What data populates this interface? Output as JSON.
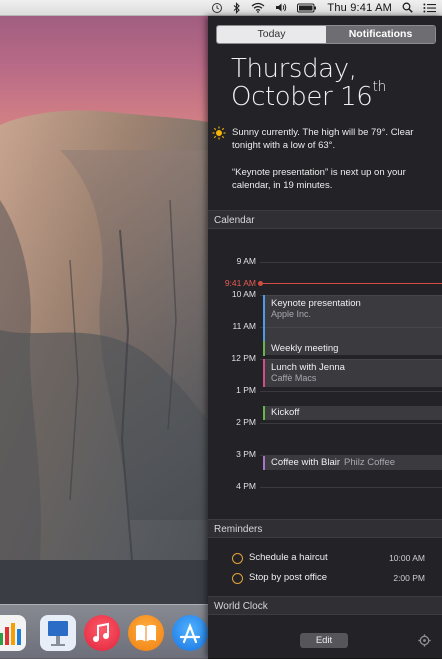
{
  "menubar": {
    "time": "Thu 9:41 AM",
    "icons": [
      "time-machine-icon",
      "bluetooth-icon",
      "wifi-icon",
      "volume-icon",
      "battery-icon",
      "spotlight-icon",
      "notification-center-icon"
    ]
  },
  "tabs": {
    "today": "Today",
    "notifications": "Notifications"
  },
  "date": {
    "day": "Thursday,",
    "month_day": "October 16",
    "suffix": "th"
  },
  "weather": {
    "text": "Sunny currently. The high will be 79°. Clear tonight with a low of 63°.",
    "icon": "sun-icon"
  },
  "next_event": "“Keynote presentation” is next up on your calendar, in 19 minutes.",
  "calendar": {
    "title": "Calendar",
    "now_label": "9:41 AM",
    "hours": [
      "9 AM",
      "10 AM",
      "11 AM",
      "12 PM",
      "1 PM",
      "2 PM",
      "3 PM",
      "4 PM"
    ],
    "events": [
      {
        "title": "Keynote presentation",
        "location": "Apple Inc.",
        "color": "#4f9be6"
      },
      {
        "title": "Weekly meeting",
        "location": "",
        "color": "#66b74a"
      },
      {
        "title": "Lunch with Jenna",
        "location": "Caffè Macs",
        "color": "#d24d8a"
      },
      {
        "title": "Kickoff",
        "location": "",
        "color": "#66b74a"
      },
      {
        "title": "Coffee with Blair",
        "location": "Philz Coffee",
        "color": "#a874c8"
      }
    ]
  },
  "reminders": {
    "title": "Reminders",
    "items": [
      {
        "title": "Schedule a haircut",
        "time": "10:00 AM"
      },
      {
        "title": "Stop by post office",
        "time": "2:00 PM"
      }
    ]
  },
  "world_clock": {
    "title": "World Clock"
  },
  "footer": {
    "edit_label": "Edit"
  },
  "dock": {
    "apps": [
      "numbers-icon",
      "keynote-icon",
      "itunes-icon",
      "ibooks-icon",
      "app-store-icon"
    ]
  },
  "colors": {
    "accent_now": "#d34a44",
    "reminder_circle": "#e4a23a"
  }
}
